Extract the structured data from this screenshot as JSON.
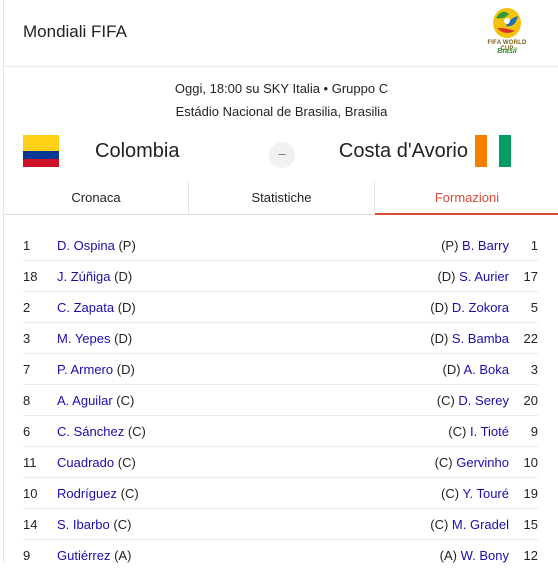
{
  "header": {
    "title": "Mondiali FIFA",
    "logo_line1": "FIFA WORLD CUP",
    "logo_line2": "Brasil"
  },
  "match": {
    "info_line1": "Oggi, 18:00 su SKY Italia • Gruppo C",
    "info_line2": "Estádio Nacional de Brasilia, Brasilia",
    "team_left": "Colombia",
    "team_right": "Costa d'Avorio",
    "separator": "–"
  },
  "colors": {
    "accent": "#dd4b39",
    "link": "#1a0dab"
  },
  "tabs": [
    {
      "label": "Cronaca"
    },
    {
      "label": "Statistiche"
    },
    {
      "label": "Formazioni",
      "active": true
    }
  ],
  "lineup": [
    {
      "num_l": "1",
      "name_l": "D. Ospina",
      "role_l": "(P)",
      "role_r": "(P)",
      "name_r": "B. Barry",
      "num_r": "1"
    },
    {
      "num_l": "18",
      "name_l": "J. Zúñiga",
      "role_l": "(D)",
      "role_r": "(D)",
      "name_r": "S. Aurier",
      "num_r": "17"
    },
    {
      "num_l": "2",
      "name_l": "C. Zapata",
      "role_l": "(D)",
      "role_r": "(D)",
      "name_r": "D. Zokora",
      "num_r": "5"
    },
    {
      "num_l": "3",
      "name_l": "M. Yepes",
      "role_l": "(D)",
      "role_r": "(D)",
      "name_r": "S. Bamba",
      "num_r": "22"
    },
    {
      "num_l": "7",
      "name_l": "P. Armero",
      "role_l": "(D)",
      "role_r": "(D)",
      "name_r": "A. Boka",
      "num_r": "3"
    },
    {
      "num_l": "8",
      "name_l": "A. Aguilar",
      "role_l": "(C)",
      "role_r": "(C)",
      "name_r": "D. Serey",
      "num_r": "20"
    },
    {
      "num_l": "6",
      "name_l": "C. Sánchez",
      "role_l": "(C)",
      "role_r": "(C)",
      "name_r": "I. Tioté",
      "num_r": "9"
    },
    {
      "num_l": "11",
      "name_l": "Cuadrado",
      "role_l": "(C)",
      "role_r": "(C)",
      "name_r": "Gervinho",
      "num_r": "10"
    },
    {
      "num_l": "10",
      "name_l": "Rodríguez",
      "role_l": "(C)",
      "role_r": "(C)",
      "name_r": "Y. Touré",
      "num_r": "19"
    },
    {
      "num_l": "14",
      "name_l": "S. Ibarbo",
      "role_l": "(C)",
      "role_r": "(C)",
      "name_r": "M. Gradel",
      "num_r": "15"
    },
    {
      "num_l": "9",
      "name_l": "Gutiérrez",
      "role_l": "(A)",
      "role_r": "(A)",
      "name_r": "W. Bony",
      "num_r": "12"
    }
  ]
}
